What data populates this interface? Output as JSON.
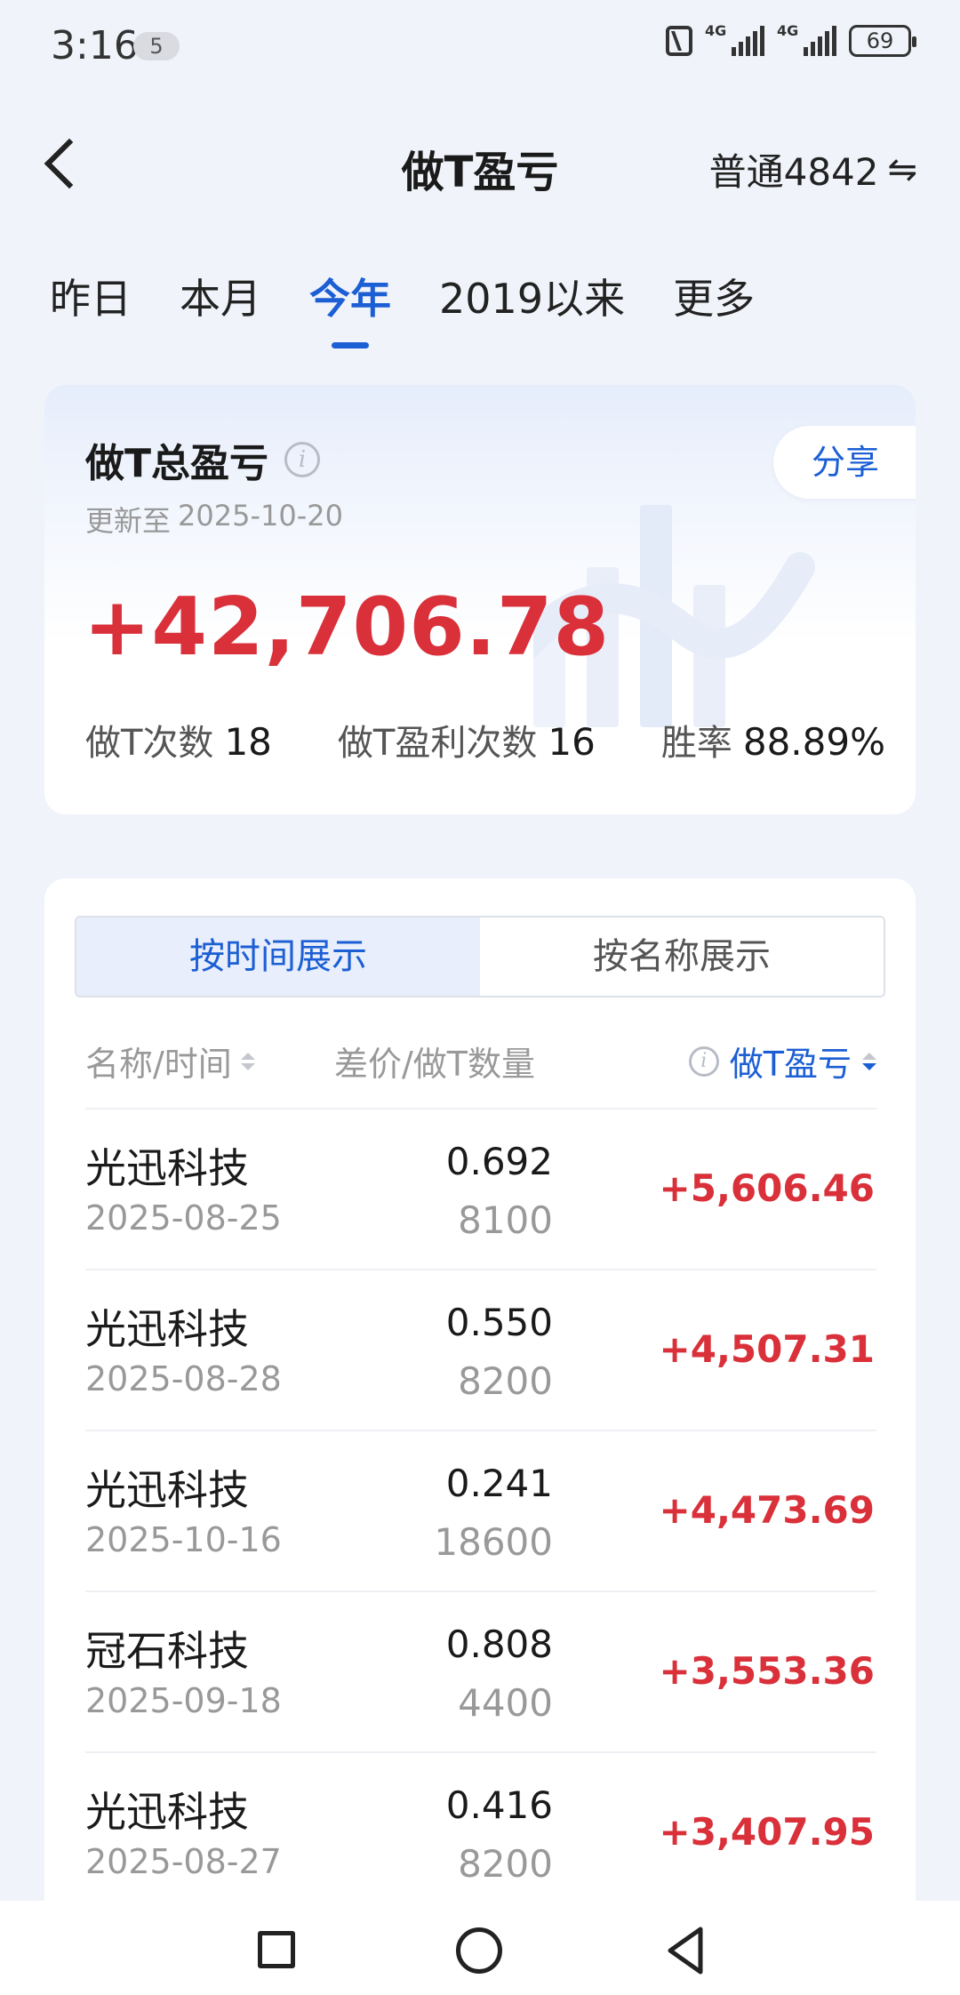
{
  "status_bar": {
    "time": "3:16",
    "notification_count": "5",
    "signal1_label": "4G",
    "signal2_label": "4G",
    "battery": "69"
  },
  "nav": {
    "title": "做T盈亏",
    "account": "普通4842",
    "swap_icon": "⇋"
  },
  "tabs": [
    {
      "label": "昨日",
      "active": false
    },
    {
      "label": "本月",
      "active": false
    },
    {
      "label": "今年",
      "active": true
    },
    {
      "label": "2019以来",
      "active": false
    },
    {
      "label": "更多",
      "active": false
    }
  ],
  "summary": {
    "title": "做T总盈亏",
    "share_label": "分享",
    "updated_prefix": "更新至",
    "updated_date": "2025-10-20",
    "total": "+42,706.78",
    "count_label": "做T次数",
    "count_value": "18",
    "profit_count_label": "做T盈利次数",
    "profit_count_value": "16",
    "winrate_label": "胜率",
    "winrate_value": "88.89%"
  },
  "list": {
    "segment": [
      {
        "label": "按时间展示",
        "active": true
      },
      {
        "label": "按名称展示",
        "active": false
      }
    ],
    "headers": {
      "name_time": "名称/时间",
      "diff_qty": "差价/做T数量",
      "pl": "做T盈亏"
    },
    "rows": [
      {
        "name": "光迅科技",
        "date": "2025-08-25",
        "diff": "0.692",
        "qty": "8100",
        "pl": "+5,606.46"
      },
      {
        "name": "光迅科技",
        "date": "2025-08-28",
        "diff": "0.550",
        "qty": "8200",
        "pl": "+4,507.31"
      },
      {
        "name": "光迅科技",
        "date": "2025-10-16",
        "diff": "0.241",
        "qty": "18600",
        "pl": "+4,473.69"
      },
      {
        "name": "冠石科技",
        "date": "2025-09-18",
        "diff": "0.808",
        "qty": "4400",
        "pl": "+3,553.36"
      },
      {
        "name": "光迅科技",
        "date": "2025-08-27",
        "diff": "0.416",
        "qty": "8200",
        "pl": "+3,407.95"
      }
    ]
  },
  "colors": {
    "accent": "#1c5fd4",
    "profit": "#d9303a",
    "background": "#f0f3fa"
  }
}
